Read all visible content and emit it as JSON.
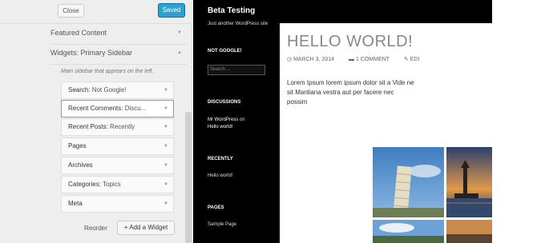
{
  "header": {
    "close_label": "Close",
    "saved_label": "Saved"
  },
  "sections": {
    "featured": "Featured Content",
    "widgets": "Widgets: Primary Sidebar"
  },
  "sidebar_description": "Main sidebar that appears on the left.",
  "widgets": [
    {
      "title": "Search:",
      "sub": " Not Google!"
    },
    {
      "title": "Recent Comments:",
      "sub": " Discu..."
    },
    {
      "title": "Recent Posts:",
      "sub": " Recently"
    },
    {
      "title": "Pages",
      "sub": ""
    },
    {
      "title": "Archives",
      "sub": ""
    },
    {
      "title": "Categories:",
      "sub": " Topics"
    },
    {
      "title": "Meta",
      "sub": ""
    }
  ],
  "actions": {
    "reorder": "Reorder",
    "add_widget": "+ Add a Widget"
  },
  "site": {
    "title": "Beta Testing",
    "description": "Just another WordPress site",
    "widget_search_title": "NOT GOOGLE!",
    "search_placeholder": "Search ...",
    "discussions_title": "DISCUSSIONS",
    "discussion_author": "Mr WordPress",
    "discussion_on": " on ",
    "discussion_post": "Hello world!",
    "recently_title": "RECENTLY",
    "recent_post": "Hello world!",
    "pages_title": "PAGES",
    "pages_item": "Sample Page"
  },
  "post": {
    "title": "HELLO WORLD!",
    "date": "MARCH 3, 2014",
    "comments": "1 COMMENT",
    "edit": "EDI",
    "body": "Lorem Ipsum lorem ipsum dolor sit a Vide ne sit Manliana vestra aut per facere nec possim"
  },
  "colors": {
    "accent": "#2ea2cc",
    "panel": "#eeeeee",
    "site_bg": "#000000"
  }
}
